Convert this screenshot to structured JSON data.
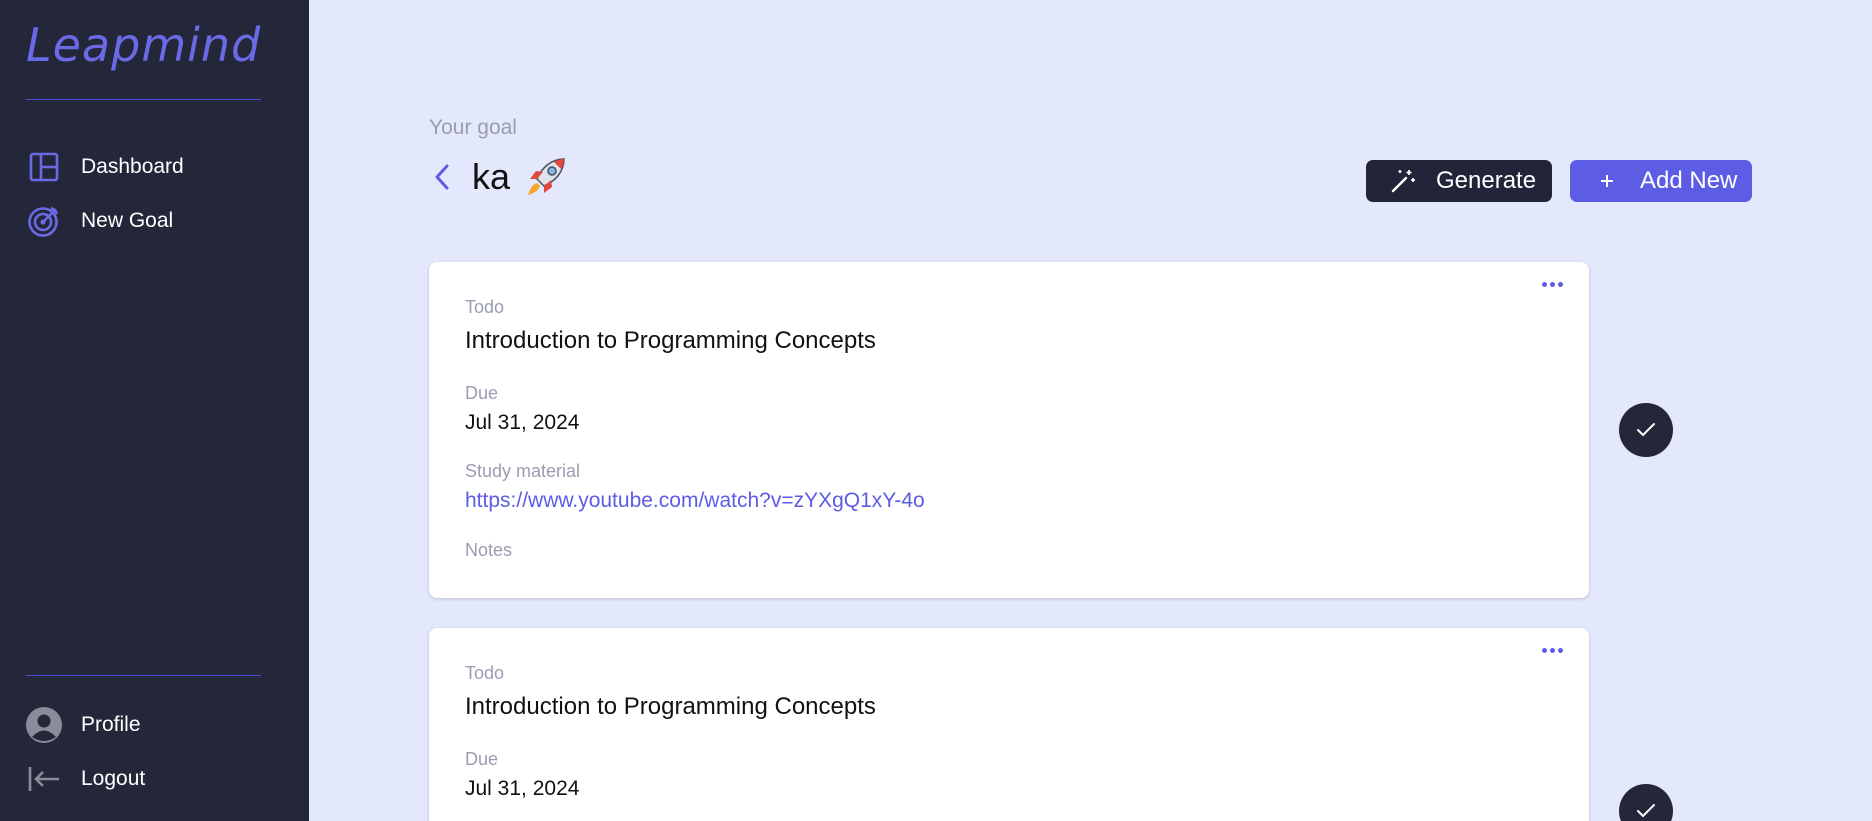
{
  "app": {
    "name": "Leapmind"
  },
  "sidebar": {
    "nav": [
      {
        "label": "Dashboard",
        "icon": "dashboard-layout-icon"
      },
      {
        "label": "New Goal",
        "icon": "target-goal-icon"
      }
    ],
    "bottom": [
      {
        "label": "Profile",
        "icon": "user-avatar-icon"
      },
      {
        "label": "Logout",
        "icon": "logout-icon"
      }
    ]
  },
  "goal": {
    "caption": "Your goal",
    "title": "ka",
    "emoji_icon": "rocket-icon"
  },
  "actions": {
    "generate_label": "Generate",
    "add_new_label": "Add New"
  },
  "tasks": [
    {
      "status": "Todo",
      "title": "Introduction to Programming Concepts",
      "due_label": "Due",
      "due": "Jul 31, 2024",
      "material_label": "Study material",
      "material_url": "https://www.youtube.com/watch?v=zYXgQ1xY-4o",
      "notes_label": "Notes"
    },
    {
      "status": "Todo",
      "title": "Introduction to Programming Concepts",
      "due_label": "Due",
      "due": "Jul 31, 2024"
    }
  ],
  "colors": {
    "sidebar_bg": "#24263a",
    "accent": "#5d5ce4",
    "page_bg": "#e3e8fd",
    "dark_button": "#22243a"
  }
}
